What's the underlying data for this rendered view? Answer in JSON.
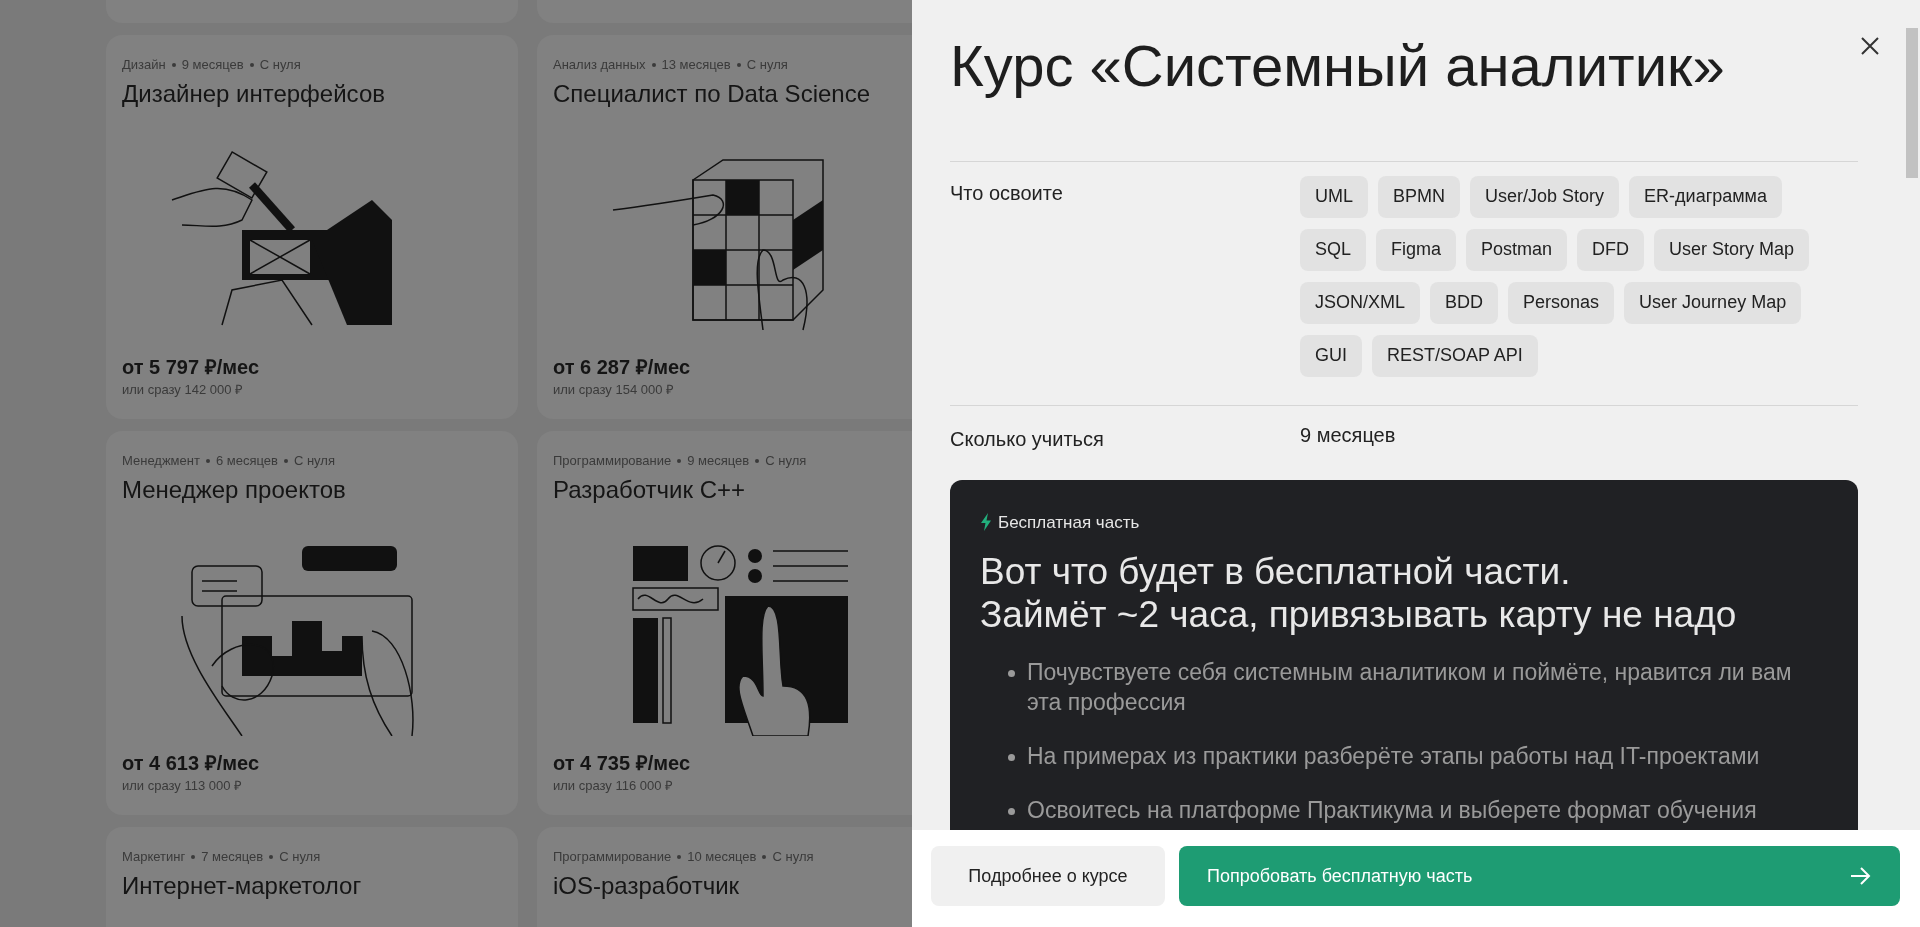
{
  "catalog": {
    "cards": [
      {
        "meta": [
          "Дизайн",
          "9 месяцев",
          "С нуля"
        ],
        "title": "Дизайнер интерфейсов",
        "price": "от 5 797 ₽/мес",
        "price_full": "или сразу 142 000 ₽"
      },
      {
        "meta": [
          "Анализ данных",
          "13 месяцев",
          "С нуля"
        ],
        "title": "Специалист по Data Science",
        "price": "от 6 287 ₽/мес",
        "price_full": "или сразу 154 000 ₽"
      },
      {
        "meta": [
          "Менеджмент",
          "6 месяцев",
          "С нуля"
        ],
        "title": "Менеджер проектов",
        "price": "от 4 613 ₽/мес",
        "price_full": "или сразу 113 000 ₽"
      },
      {
        "meta": [
          "Программирование",
          "9 месяцев",
          "С нуля"
        ],
        "title": "Разработчик С++",
        "price": "от 4 735 ₽/мес",
        "price_full": "или сразу 116 000 ₽"
      },
      {
        "meta": [
          "Маркетинг",
          "7 месяцев",
          "С нуля"
        ],
        "title": "Интернет-маркетолог"
      },
      {
        "meta": [
          "Программирование",
          "10 месяцев",
          "С нуля"
        ],
        "title": "iOS-разработчик"
      }
    ]
  },
  "panel": {
    "title": "Курс «Системный аналитик»",
    "skills_label": "Что освоите",
    "skills": [
      "UML",
      "BPMN",
      "User/Job Story",
      "ER-диаграмма",
      "SQL",
      "Figma",
      "Postman",
      "DFD",
      "User Story Map",
      "JSON/XML",
      "BDD",
      "Personas",
      "User Journey Map",
      "GUI",
      "REST/SOAP API"
    ],
    "duration_label": "Сколько учиться",
    "duration": "9 месяцев",
    "free_part": {
      "badge": "Бесплатная часть",
      "heading": "Вот что будет в бесплатной части.\nЗаймёт ~2 часа, привязывать карту не надо",
      "bullets": [
        "Почувствуете себя системным аналитиком и поймёте, нравится ли вам эта профессия",
        "На примерах из практики разберёте этапы работы над IT-проектами",
        "Освоитесь на платформе Практикума и выберете формат обучения"
      ]
    },
    "buttons": {
      "details": "Подробнее о курсе",
      "try": "Попробовать бесплатную часть"
    }
  }
}
